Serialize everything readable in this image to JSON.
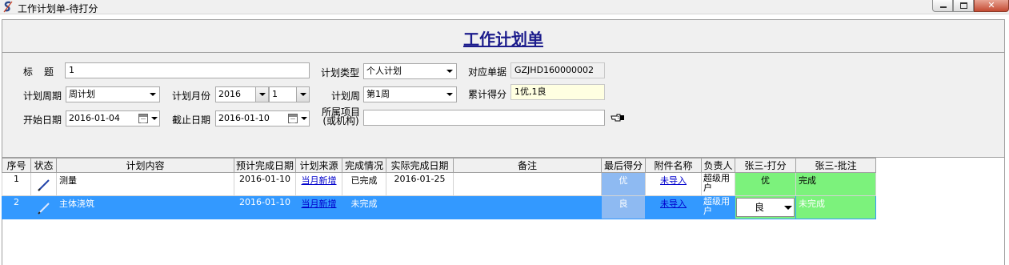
{
  "window": {
    "title": "工作计划单-待打分",
    "close_symbol": "✕"
  },
  "form": {
    "heading": "工作计划单",
    "title_label": "标　题",
    "title_value": "1",
    "plan_type_label": "计划类型",
    "plan_type_value": "个人计划",
    "doc_no_label": "对应单据",
    "doc_no_value": "GZJHD160000002",
    "period_label": "计划周期",
    "period_value": "周计划",
    "month_label": "计划月份",
    "year_value": "2016",
    "month_value": "1",
    "week_label": "计划周",
    "week_value": "第1周",
    "score_label": "累计得分",
    "score_value": "1优,1良",
    "start_label": "开始日期",
    "start_value": "2016-01-04",
    "end_label": "截止日期",
    "end_value": "2016-01-10",
    "project_label_line1": "所属项目",
    "project_label_line2": "(或机构)",
    "project_value": "",
    "hand_icon": "pointing-hand-icon"
  },
  "table": {
    "columns": [
      "序号",
      "状态",
      "计划内容",
      "预计完成日期",
      "计划来源",
      "完成情况",
      "实际完成日期",
      "备注",
      "最后得分",
      "附件名称",
      "负责人",
      "张三-打分",
      "张三-批注"
    ],
    "rows": [
      {
        "no": "1",
        "content": "测量",
        "due": "2016-01-10",
        "source": "当月新增",
        "status": "已完成",
        "actual": "2016-01-25",
        "remark": "",
        "final": "优",
        "attachment": "未导入",
        "owner": "超级用户",
        "grade": "优",
        "comment": "完成"
      },
      {
        "no": "2",
        "content": "主体浇筑",
        "due": "2016-01-10",
        "source": "当月新增",
        "status": "未完成",
        "actual": "",
        "remark": "",
        "final": "良",
        "attachment": "未导入",
        "owner": "超级用户",
        "grade": "良",
        "comment": "未完成"
      }
    ]
  },
  "colors": {
    "heading": "#1c1c8c",
    "selection": "#3399ff",
    "final_score_bg": "#8ebaf2",
    "grade_bg": "#7cf27c"
  }
}
